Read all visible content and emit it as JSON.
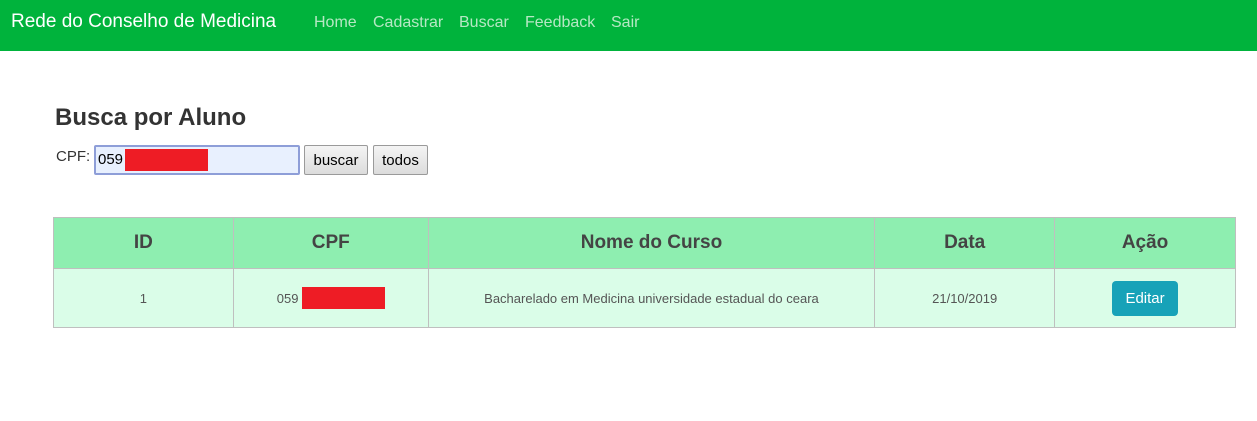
{
  "navbar": {
    "brand": "Rede do Conselho de Medicina",
    "links": [
      "Home",
      "Cadastrar",
      "Buscar",
      "Feedback",
      "Sair"
    ]
  },
  "search": {
    "title": "Busca por Aluno",
    "cpf_label": "CPF:",
    "cpf_value_visible": "059",
    "buscar_label": "buscar",
    "todos_label": "todos"
  },
  "table": {
    "headers": [
      "ID",
      "CPF",
      "Nome do Curso",
      "Data",
      "Ação"
    ],
    "rows": [
      {
        "id": "1",
        "cpf_visible": "059",
        "course": "Bacharelado em Medicina universidade estadual do ceara",
        "date": "21/10/2019",
        "action_label": "Editar"
      }
    ]
  },
  "colors": {
    "navbar_bg": "#00b33c",
    "header_bg": "#8eeeb0",
    "row_bg": "#dafde8",
    "edit_button": "#17a2b8",
    "redaction": "#ee1c25"
  }
}
